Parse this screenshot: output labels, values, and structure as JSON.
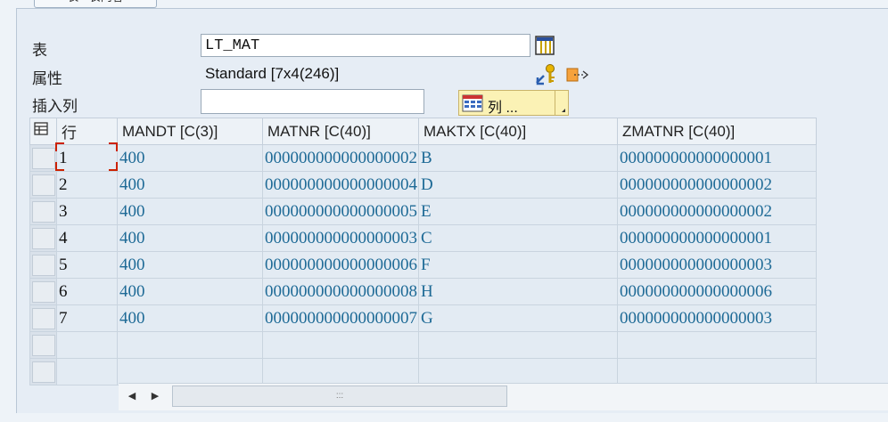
{
  "tab": {
    "label": "表 - 表内容"
  },
  "form": {
    "table_label": "表",
    "table_value": "LT_MAT",
    "attribute_label": "属性",
    "attribute_value": "Standard [7x4(246)]",
    "insert_column_label": "插入列",
    "insert_column_value": "",
    "columns_button_label": "列 ..."
  },
  "grid": {
    "headers": [
      "行",
      "MANDT [C(3)]",
      "MATNR [C(40)]",
      "MAKTX [C(40)]",
      "ZMATNR [C(40)]"
    ],
    "rows": [
      [
        "1",
        "400",
        "000000000000000002",
        "B",
        "000000000000000001"
      ],
      [
        "2",
        "400",
        "000000000000000004",
        "D",
        "000000000000000002"
      ],
      [
        "3",
        "400",
        "000000000000000005",
        "E",
        "000000000000000002"
      ],
      [
        "4",
        "400",
        "000000000000000003",
        "C",
        "000000000000000001"
      ],
      [
        "5",
        "400",
        "000000000000000006",
        "F",
        "000000000000000003"
      ],
      [
        "6",
        "400",
        "000000000000000008",
        "H",
        "000000000000000006"
      ],
      [
        "7",
        "400",
        "000000000000000007",
        "G",
        "000000000000000003"
      ]
    ]
  },
  "icons": {
    "table_layout": "table-grid-icon",
    "key": "key-icon",
    "export": "export-icon",
    "columns": "column-grid-icon",
    "select_all": "select-all-icon",
    "scroll_left": "scroll-left-icon",
    "scroll_right": "scroll-right-icon"
  }
}
